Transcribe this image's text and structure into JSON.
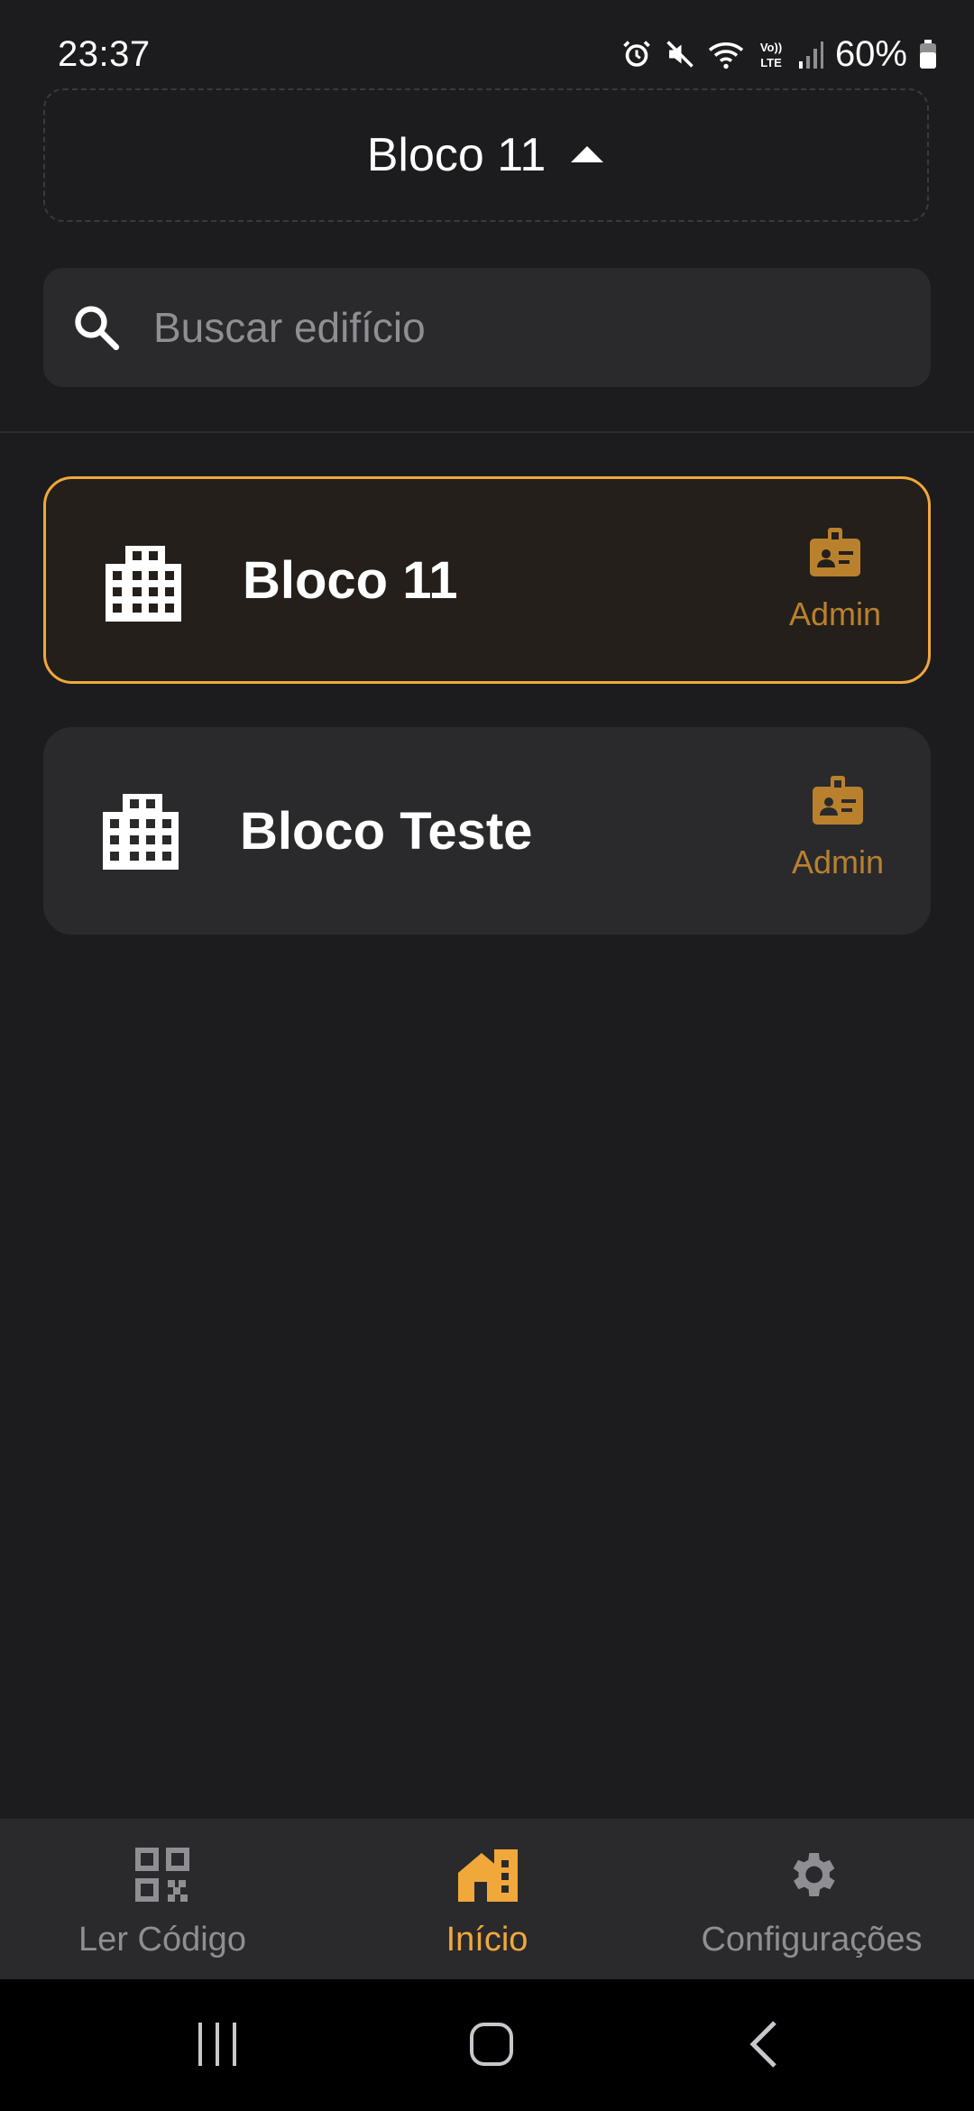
{
  "status_bar": {
    "time": "23:37",
    "battery_percent": "60%",
    "icons": [
      "alarm-icon",
      "mute-icon",
      "wifi-icon",
      "volte-icon",
      "signal-icon",
      "battery-icon"
    ]
  },
  "header": {
    "selected_building": "Bloco 11",
    "toggle_icon": "caret-up-icon"
  },
  "search": {
    "placeholder": "Buscar edifício",
    "value": ""
  },
  "buildings": [
    {
      "name": "Bloco 11",
      "role": "Admin",
      "selected": true,
      "icon": "building-icon",
      "role_icon": "badge-icon"
    },
    {
      "name": "Bloco Teste",
      "role": "Admin",
      "selected": false,
      "icon": "building-icon",
      "role_icon": "badge-icon"
    }
  ],
  "bottom_nav": {
    "items": [
      {
        "label": "Ler Código",
        "icon": "qr-code-icon",
        "active": false
      },
      {
        "label": "Início",
        "icon": "home-icon",
        "active": true
      },
      {
        "label": "Configurações",
        "icon": "gear-icon",
        "active": false
      }
    ]
  },
  "colors": {
    "background": "#1c1c1e",
    "surface": "#2a2a2d",
    "accent": "#f0a83a",
    "role_accent": "#b9812e",
    "muted": "#8e8e93"
  }
}
